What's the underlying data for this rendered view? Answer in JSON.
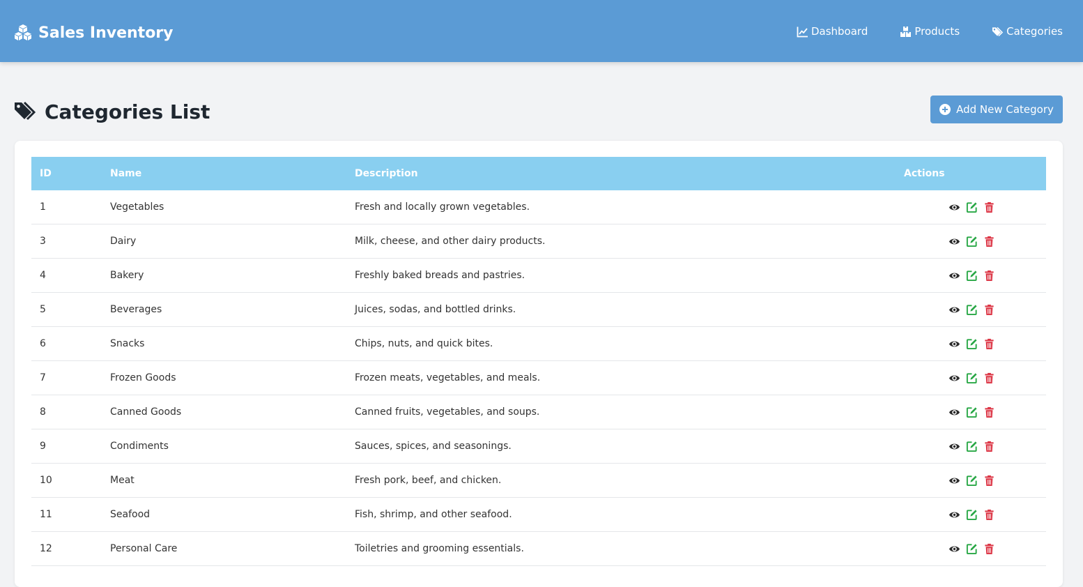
{
  "nav": {
    "brand": "Sales Inventory",
    "brand_icon": "cubes-icon",
    "links": [
      {
        "label": "Dashboard",
        "icon": "chart-line-icon"
      },
      {
        "label": "Products",
        "icon": "boxes-icon"
      },
      {
        "label": "Categories",
        "icon": "tags-icon"
      }
    ]
  },
  "page": {
    "title": "Categories List",
    "title_icon": "tags-icon",
    "add_button": "Add New Category"
  },
  "table": {
    "headers": {
      "id": "ID",
      "name": "Name",
      "description": "Description",
      "actions": "Actions"
    },
    "rows": [
      {
        "id": "1",
        "name": "Vegetables",
        "description": "Fresh and locally grown vegetables."
      },
      {
        "id": "3",
        "name": "Dairy",
        "description": "Milk, cheese, and other dairy products."
      },
      {
        "id": "4",
        "name": "Bakery",
        "description": "Freshly baked breads and pastries."
      },
      {
        "id": "5",
        "name": "Beverages",
        "description": "Juices, sodas, and bottled drinks."
      },
      {
        "id": "6",
        "name": "Snacks",
        "description": "Chips, nuts, and quick bites."
      },
      {
        "id": "7",
        "name": "Frozen Goods",
        "description": "Frozen meats, vegetables, and meals."
      },
      {
        "id": "8",
        "name": "Canned Goods",
        "description": "Canned fruits, vegetables, and soups."
      },
      {
        "id": "9",
        "name": "Condiments",
        "description": "Sauces, spices, and seasonings."
      },
      {
        "id": "10",
        "name": "Meat",
        "description": "Fresh pork, beef, and chicken."
      },
      {
        "id": "11",
        "name": "Seafood",
        "description": "Fish, shrimp, and other seafood."
      },
      {
        "id": "12",
        "name": "Personal Care",
        "description": "Toiletries and grooming essentials."
      }
    ],
    "action_icons": [
      "eye-icon",
      "edit-icon",
      "trash-icon"
    ]
  },
  "colors": {
    "navbar": "#5b9bd5",
    "table_header": "#89cff0",
    "view_icon": "#2b2b2b",
    "edit_icon": "#28a745",
    "delete_icon": "#dc3545"
  }
}
